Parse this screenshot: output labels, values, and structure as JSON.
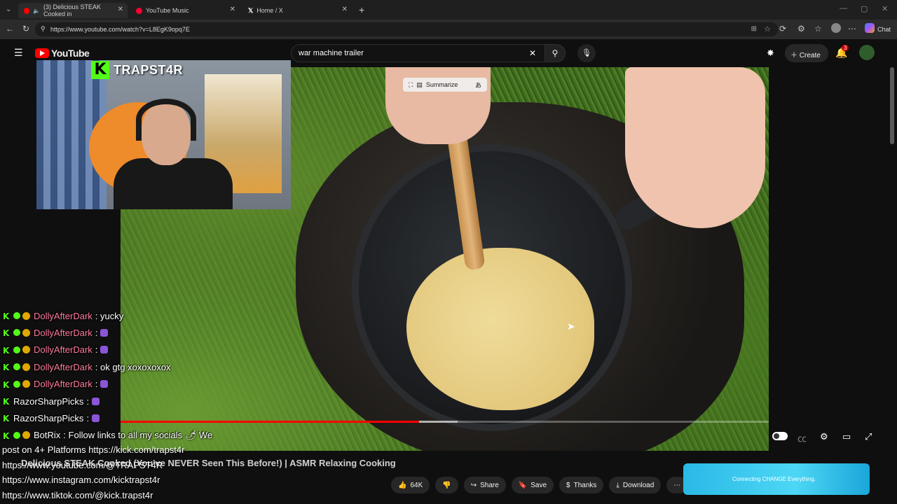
{
  "browser": {
    "tabs": [
      {
        "label": "(3) Delicious STEAK Cooked in"
      },
      {
        "label": "YouTube Music"
      },
      {
        "label": "Home / X"
      }
    ],
    "url": "https://www.youtube.com/watch?v=L8EgK9opq7E",
    "chat_label": "Chat"
  },
  "youtube": {
    "logo_text": "YouTube",
    "search_value": "war machine trailer",
    "create_label": "Create",
    "notification_count": "3",
    "summarize_label": "Summarize"
  },
  "stream": {
    "channel_name": "TRAPST4R"
  },
  "chat": [
    {
      "user": "DollyAfterDark",
      "msg": ": yucky",
      "color": "#ff7b9c"
    },
    {
      "user": "DollyAfterDark",
      "msg": ":",
      "color": "#ff7b9c"
    },
    {
      "user": "DollyAfterDark",
      "msg": ":",
      "color": "#ff7b9c"
    },
    {
      "user": "DollyAfterDark",
      "msg": ": ok gtg xoxoxoxox",
      "color": "#ff7b9c"
    },
    {
      "user": "DollyAfterDark",
      "msg": ":",
      "color": "#ff7b9c"
    },
    {
      "user": "RazorSharpPicks",
      "msg": ":",
      "color": "#ffffff"
    },
    {
      "user": "RazorSharpPicks",
      "msg": ":",
      "color": "#ffffff"
    },
    {
      "user": "BotRix",
      "msg": ": Follow links to all my socials 🌶 We",
      "color": "#ffffff"
    }
  ],
  "links": [
    "post on 4+ Platforms https://kick.com/trapst4r",
    "https://www.youtube.com/@TRAPST4R",
    "https://www.instagram.com/kicktrapst4r",
    "https://www.tiktok.com/@kick.trapst4r"
  ],
  "video": {
    "title": "Delicious STEAK Cooked (You've NEVER Seen This Before!) | ASMR Relaxing Cooking",
    "progress": 0.46,
    "buffered": 0.52
  },
  "actions": {
    "like_count": "64K",
    "share": "Share",
    "save": "Save",
    "thanks": "Thanks",
    "download": "Download"
  },
  "ad": {
    "text": "Connecting CHANGE Everything."
  },
  "colors": {
    "kick_green": "#53fc18",
    "youtube_red": "#ff0000"
  }
}
